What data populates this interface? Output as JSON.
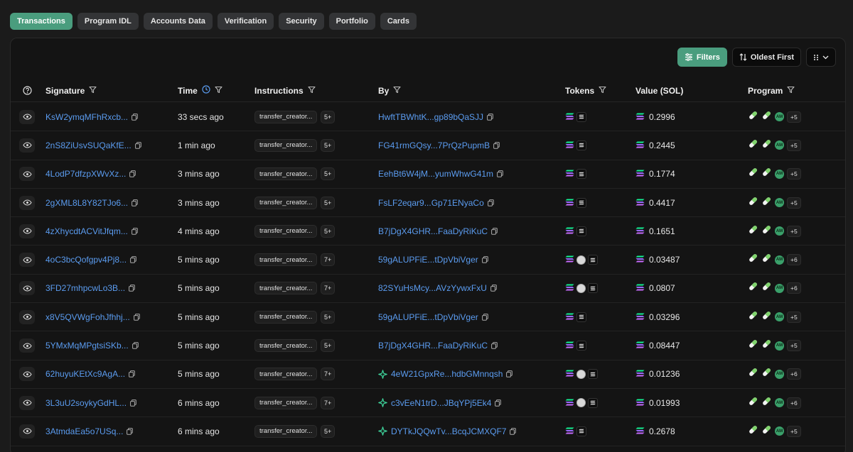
{
  "tabs": [
    "Transactions",
    "Program IDL",
    "Accounts Data",
    "Verification",
    "Security",
    "Portfolio",
    "Cards"
  ],
  "active_tab": "Transactions",
  "toolbar": {
    "filters_label": "Filters",
    "sort_label": "Oldest First"
  },
  "columns": {
    "signature": "Signature",
    "time": "Time",
    "instructions": "Instructions",
    "by": "By",
    "tokens": "Tokens",
    "value": "Value (SOL)",
    "program": "Program"
  },
  "colors": {
    "accent": "#4a9d7e",
    "link": "#5b9cf0",
    "background": "#141414"
  },
  "rows": [
    {
      "signature": "KsW2ymqMFhRxcb...",
      "time": "33 secs ago",
      "instruction": "transfer_creator...",
      "count": "5+",
      "by": "HwftTBWhtK...gp89bQaSJJ",
      "by_icon": false,
      "tokens": 2,
      "value": "0.2996",
      "program_more": "+5"
    },
    {
      "signature": "2nS8ZiUsvSUQaKfE...",
      "time": "1 min ago",
      "instruction": "transfer_creator...",
      "count": "5+",
      "by": "FG41rmGQsy...7PrQzPupmB",
      "by_icon": false,
      "tokens": 2,
      "value": "0.2445",
      "program_more": "+5"
    },
    {
      "signature": "4LodP7dfzpXWvXz...",
      "time": "3 mins ago",
      "instruction": "transfer_creator...",
      "count": "5+",
      "by": "EehBt6W4jM...yumWhwG41m",
      "by_icon": false,
      "tokens": 2,
      "value": "0.1774",
      "program_more": "+5"
    },
    {
      "signature": "2gXML8L8Y82TJo6...",
      "time": "3 mins ago",
      "instruction": "transfer_creator...",
      "count": "5+",
      "by": "FsLF2eqar9...Gp71ENyaCo",
      "by_icon": false,
      "tokens": 2,
      "value": "0.4417",
      "program_more": "+5"
    },
    {
      "signature": "4zXhycdtACVitJfqm...",
      "time": "4 mins ago",
      "instruction": "transfer_creator...",
      "count": "5+",
      "by": "B7jDgX4GHR...FaaDyRiKuC",
      "by_icon": false,
      "tokens": 2,
      "value": "0.1651",
      "program_more": "+5"
    },
    {
      "signature": "4oC3bcQofgpv4Pj8...",
      "time": "5 mins ago",
      "instruction": "transfer_creator...",
      "count": "7+",
      "by": "59gALUPFiE...tDpVbiVger",
      "by_icon": false,
      "tokens": 3,
      "value": "0.03487",
      "program_more": "+6"
    },
    {
      "signature": "3FD27mhpcwLo3B...",
      "time": "5 mins ago",
      "instruction": "transfer_creator...",
      "count": "7+",
      "by": "82SYuHsMcy...AVzYywxFxU",
      "by_icon": false,
      "tokens": 3,
      "value": "0.0807",
      "program_more": "+6"
    },
    {
      "signature": "x8V5QVWgFohJfhhj...",
      "time": "5 mins ago",
      "instruction": "transfer_creator...",
      "count": "5+",
      "by": "59gALUPFiE...tDpVbiVger",
      "by_icon": false,
      "tokens": 2,
      "value": "0.03296",
      "program_more": "+5"
    },
    {
      "signature": "5YMxMqMPgtsiSKb...",
      "time": "5 mins ago",
      "instruction": "transfer_creator...",
      "count": "5+",
      "by": "B7jDgX4GHR...FaaDyRiKuC",
      "by_icon": false,
      "tokens": 2,
      "value": "0.08447",
      "program_more": "+5"
    },
    {
      "signature": "62huyuKEtXc9AgA...",
      "time": "5 mins ago",
      "instruction": "transfer_creator...",
      "count": "7+",
      "by": "4eW21GpxRe...hdbGMnnqsh",
      "by_icon": true,
      "tokens": 3,
      "value": "0.01236",
      "program_more": "+6"
    },
    {
      "signature": "3L3uU2soykyGdHL...",
      "time": "6 mins ago",
      "instruction": "transfer_creator...",
      "count": "7+",
      "by": "c3vEeN1trD...JBqYPj5Ek4",
      "by_icon": true,
      "tokens": 3,
      "value": "0.01993",
      "program_more": "+6"
    },
    {
      "signature": "3AtmdaEa5o7USq...",
      "time": "6 mins ago",
      "instruction": "transfer_creator...",
      "count": "5+",
      "by": "DYTkJQQwTv...BcqJCMXQF7",
      "by_icon": true,
      "tokens": 2,
      "value": "0.2678",
      "program_more": "+5"
    }
  ]
}
